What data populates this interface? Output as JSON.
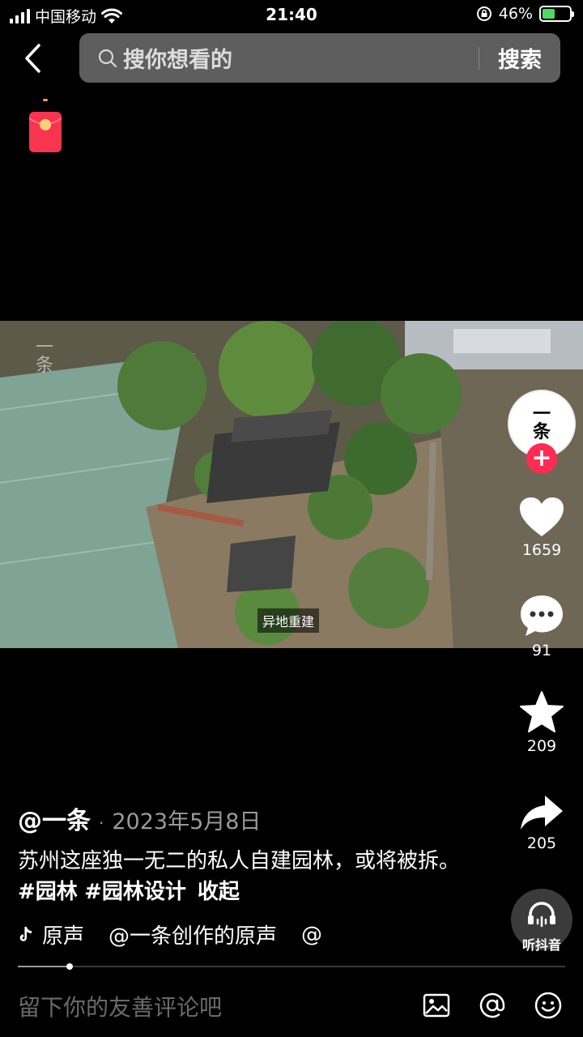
{
  "status_bar": {
    "carrier": "中国移动",
    "time": "21:40",
    "battery_percent": "46%",
    "battery_level": 0.46,
    "icons": [
      "signal-icon",
      "wifi-icon",
      "orientation-lock-icon",
      "battery-charging-icon"
    ]
  },
  "header": {
    "search_placeholder": "搜你想看的",
    "search_button": "搜索",
    "icons": [
      "back-arrow-icon",
      "search-icon",
      "red-packet-icon"
    ]
  },
  "video": {
    "caption": "异地重建",
    "watermark": "一条",
    "progress": 0.095
  },
  "rail": {
    "avatar_text": "一条",
    "follow_label": "+",
    "likes": "1659",
    "comments": "91",
    "favorites": "209",
    "shares": "205",
    "listen_label": "听抖音",
    "icons": [
      "heart-icon",
      "comment-icon",
      "star-icon",
      "share-icon",
      "headphones-icon"
    ]
  },
  "post": {
    "author": "@一条",
    "separator": "·",
    "date": "2023年5月8日",
    "description": "苏州这座独一无二的私人自建园林，或将被拆。",
    "hashtags": [
      "#园林",
      "#园林设计"
    ],
    "collapse_label": "收起",
    "music_original": "原声",
    "music_title": "@一条创作的原声",
    "music_tail": "@"
  },
  "comment_bar": {
    "placeholder": "留下你的友善评论吧",
    "icons": [
      "image-icon",
      "at-icon",
      "emoji-icon"
    ]
  },
  "colors": {
    "accent": "#fe2c55",
    "search_bg": "#5e5e5e",
    "battery_green": "#4cd964"
  }
}
